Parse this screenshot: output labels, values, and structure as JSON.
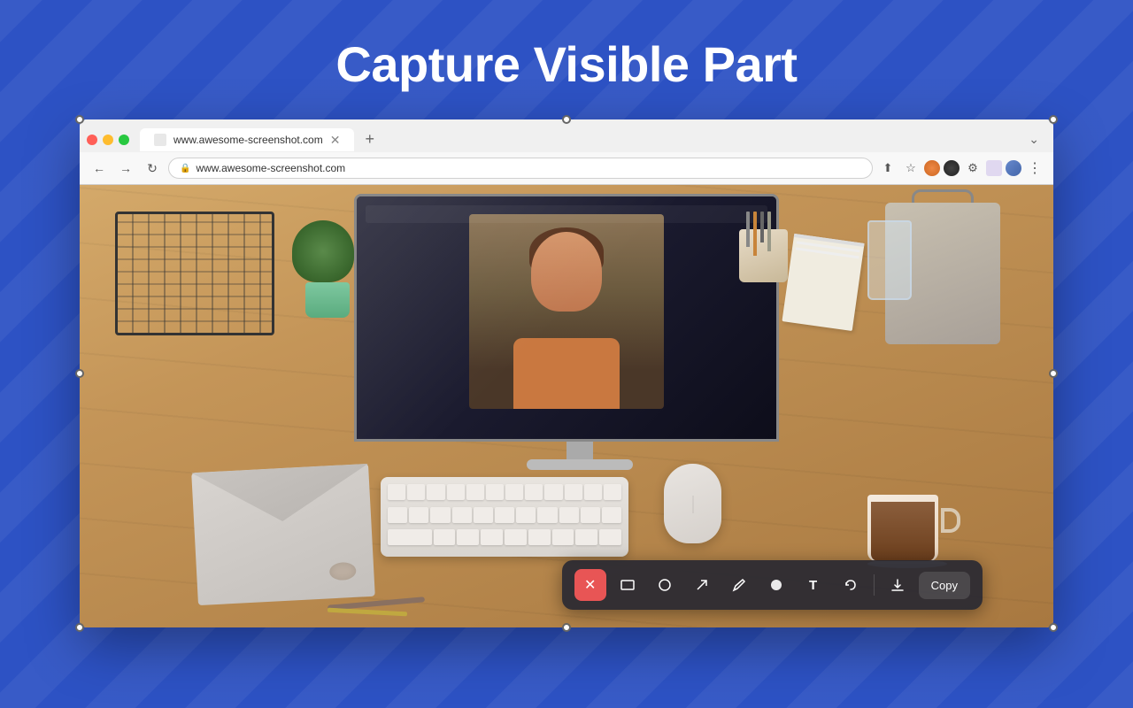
{
  "page": {
    "title": "Capture Visible Part",
    "background_color": "#2d52c4"
  },
  "browser": {
    "tab_label": "www.awesome-screenshot.com",
    "url": "www.awesome-screenshot.com",
    "new_tab_symbol": "+",
    "expand_symbol": "⌄"
  },
  "toolbar": {
    "close_icon": "✕",
    "rectangle_icon": "□",
    "circle_icon": "○",
    "arrow_icon": "↗",
    "pen_icon": "✏",
    "fill_icon": "⬟",
    "text_icon": "T",
    "undo_icon": "↩",
    "download_icon": "⬇",
    "copy_label": "Copy"
  },
  "handles": [
    "tl",
    "tc",
    "tr",
    "ml",
    "mr",
    "bl",
    "bc",
    "br"
  ]
}
